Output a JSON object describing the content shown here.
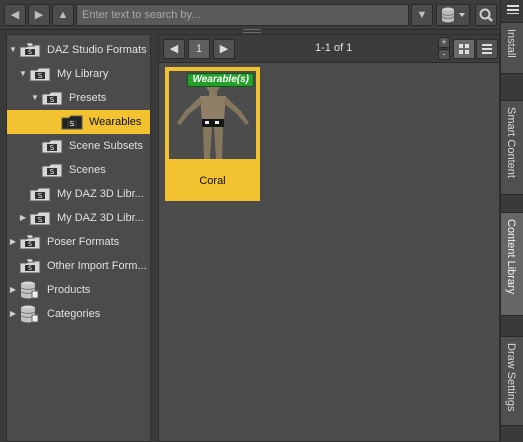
{
  "search": {
    "placeholder": "Enter text to search by..."
  },
  "tree": {
    "items": [
      {
        "label": "DAZ Studio Formats",
        "icon": "cube-folder-icon",
        "level": 0,
        "expanded": true
      },
      {
        "label": "My Library",
        "icon": "studio-folder-icon",
        "level": 1,
        "expanded": true
      },
      {
        "label": "Presets",
        "icon": "studio-folder-icon",
        "level": 2,
        "expanded": true
      },
      {
        "label": "Wearables",
        "icon": "studio-folder-icon",
        "level": 3,
        "selected": true
      },
      {
        "label": "Scene Subsets",
        "icon": "studio-folder-icon",
        "level": 2
      },
      {
        "label": "Scenes",
        "icon": "studio-folder-icon",
        "level": 2
      },
      {
        "label": "My DAZ 3D Libr...",
        "icon": "studio-folder-icon",
        "level": 1
      },
      {
        "label": "My DAZ 3D Libr...",
        "icon": "studio-folder-icon",
        "level": 1,
        "collapsed": true
      },
      {
        "label": "Poser Formats",
        "icon": "cube-folder-icon",
        "level": 0,
        "collapsed": true
      },
      {
        "label": "Other Import Form...",
        "icon": "cube-folder-icon",
        "level": 0
      },
      {
        "label": "Products",
        "icon": "database-icon",
        "level": 0,
        "collapsed": true
      },
      {
        "label": "Categories",
        "icon": "database-icon",
        "level": 0,
        "collapsed": true
      }
    ]
  },
  "pager": {
    "page": "1",
    "range": "1-1 of 1"
  },
  "content": {
    "items": [
      {
        "label": "Coral",
        "badge": "Wearable(s)"
      }
    ]
  },
  "side_tabs": [
    {
      "label": "Install"
    },
    {
      "label": "Smart Content"
    },
    {
      "label": "Content Library",
      "active": true
    },
    {
      "label": "Draw Settings"
    }
  ],
  "colors": {
    "accent": "#f2c230",
    "badge": "#25a02a",
    "panel": "#4b4b4b"
  }
}
